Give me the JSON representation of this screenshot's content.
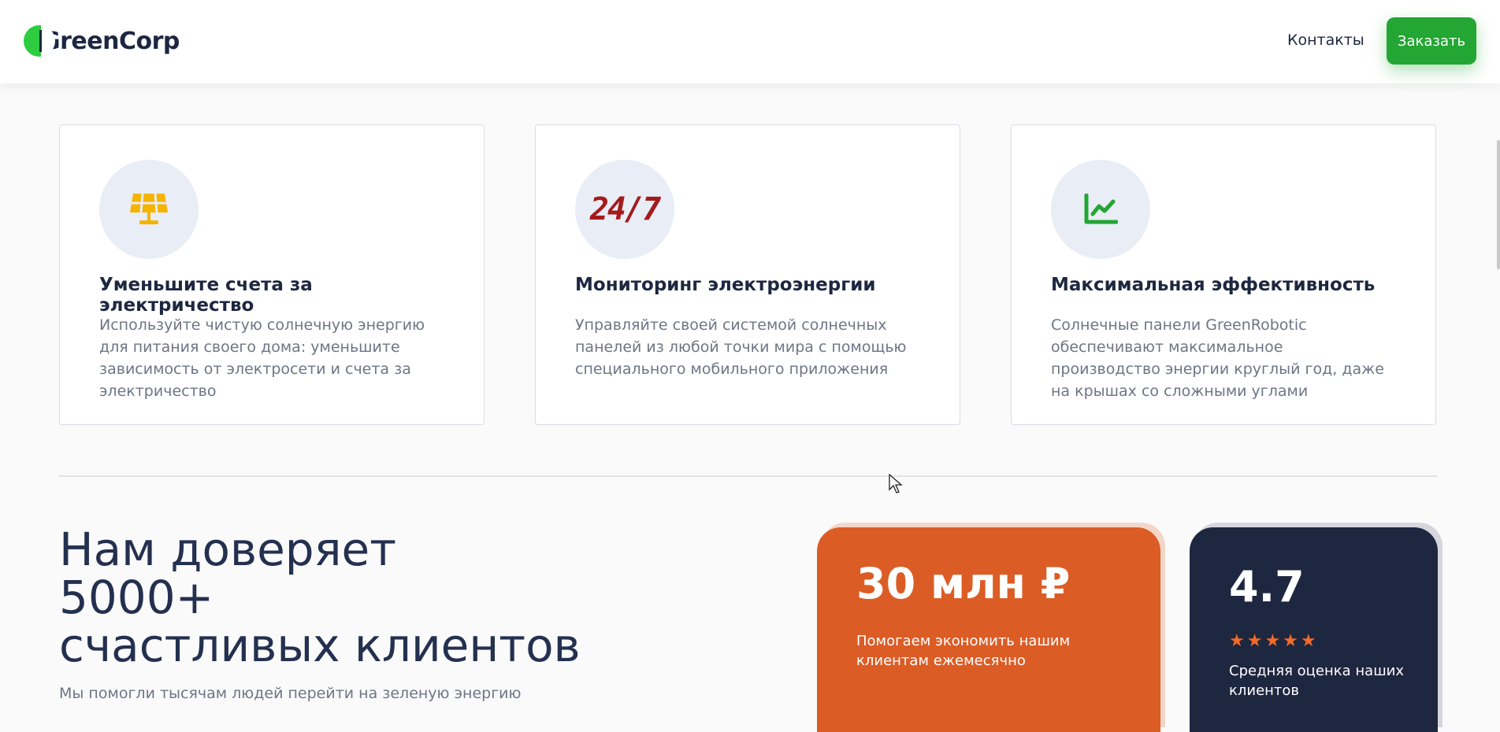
{
  "header": {
    "logo_text": "GreenCorp",
    "nav_contacts": "Контакты",
    "order_button": "Заказать"
  },
  "features": [
    {
      "icon": "solar-panel-icon",
      "title": "Уменьшите счета за электричество",
      "text": "Используйте чистую солнечную энергию для питания своего дома: уменьшите зависимость от электросети и счета за электричество"
    },
    {
      "icon": "24-7-icon",
      "icon_text": "24/7",
      "title": "Мониторинг электроэнергии",
      "text": "Управляйте своей системой солнечных панелей из любой точки мира с помощью специального мобильного приложения"
    },
    {
      "icon": "chart-line-icon",
      "title": "Максимальная эффективность",
      "text": "Солнечные панели GreenRobotic обеспечивают максимальное производство энергии круглый год, даже на крышах со сложными углами"
    }
  ],
  "trust": {
    "title_line1": "Нам доверяет",
    "title_line2": "5000+",
    "title_line3": "счастливых клиентов",
    "subtitle": "Мы помогли тысячам людей перейти на зеленую энергию"
  },
  "stats": {
    "savings_value": "30 млн ₽",
    "savings_label": "Помогаем экономить нашим клиентам ежемесячно",
    "rating_value": "4.7",
    "rating_stars": "★★★★★",
    "rating_label": "Средняя оценка наших клиентов"
  },
  "colors": {
    "brand_green": "#23a633",
    "accent_orange": "#dc5c26",
    "dark_navy": "#1e2740",
    "solar_icon": "#f5b400"
  }
}
